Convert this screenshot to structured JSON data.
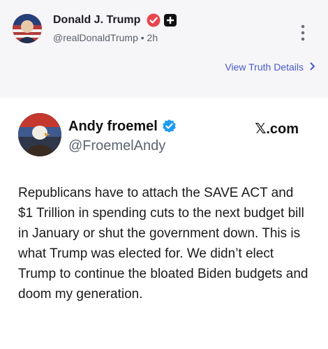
{
  "post": {
    "author_name": "Donald J. Trump",
    "handle": "@realDonaldTrump",
    "separator": "•",
    "time": "2h",
    "view_details_label": "View Truth Details",
    "icons": {
      "verified": "verified-badge-icon",
      "plus": "plus-badge-icon",
      "more": "more-vertical-icon",
      "chevron": "chevron-right-icon"
    },
    "colors": {
      "verified": "#e8464e",
      "link": "#4a59c9"
    }
  },
  "embed": {
    "author_name": "Andy froemel",
    "handle": "@FroemelAndy",
    "source": "𝕏.com",
    "text": "Republicans have to attach the SAVE ACT and $1 Trillion in spending cuts to the next budget bill in January or shut the government down. This is what Trump was elected for. We didn’t elect Trump to continue the bloated Biden budgets and doom my generation.",
    "icons": {
      "verified": "verified-badge-icon"
    },
    "colors": {
      "verified": "#1d9bf0"
    }
  }
}
